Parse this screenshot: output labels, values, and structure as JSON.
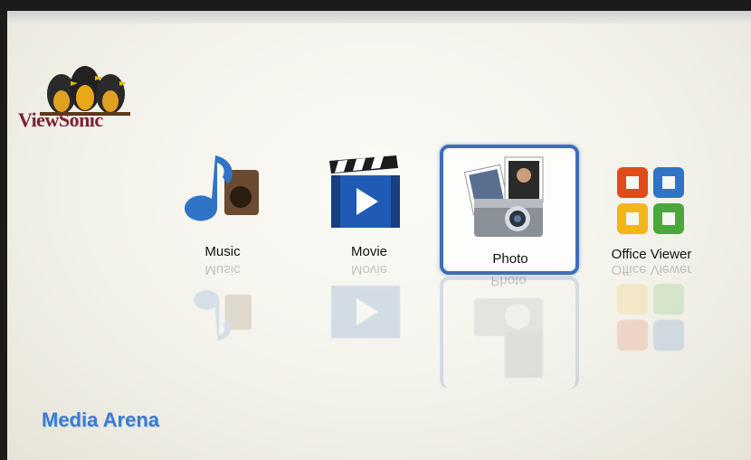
{
  "brand": {
    "logo_text": "ViewSonic",
    "icon": "three-birds-logo"
  },
  "menu": {
    "items": [
      {
        "id": "music",
        "label": "Music",
        "icon": "music-note-icon",
        "selected": false
      },
      {
        "id": "movie",
        "label": "Movie",
        "icon": "clapperboard-icon",
        "selected": false
      },
      {
        "id": "photo",
        "label": "Photo",
        "icon": "camera-photos-icon",
        "selected": true
      },
      {
        "id": "office",
        "label": "Office Viewer",
        "icon": "office-icon",
        "selected": false
      }
    ]
  },
  "footer": {
    "title": "Media Arena"
  },
  "colors": {
    "accent": "#3d6fb8",
    "title": "#3b7bd0",
    "brand": "#7b2233"
  }
}
